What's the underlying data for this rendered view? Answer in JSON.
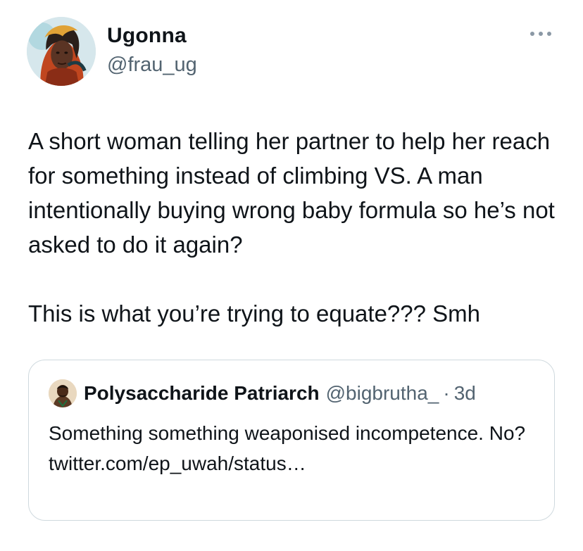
{
  "author": {
    "name": "Ugonna",
    "handle": "@frau_ug",
    "avatar_icon": "portrait-avatar-icon"
  },
  "menu": {
    "icon": "more-options-icon"
  },
  "tweet": {
    "paragraphs": [
      "A short woman telling her partner to help her reach for something instead of climbing VS. A man intentionally buying wrong baby formula so he’s not asked to do it again?",
      "This is what you’re trying to equate??? Smh"
    ]
  },
  "quoted": {
    "name": "Polysaccharide Patriarch",
    "handle": "@bigbrutha_",
    "separator": "·",
    "time": "3d",
    "text": "Something something weaponised incompetence. No? twitter.com/ep_uwah/status…",
    "avatar_icon": "portrait-avatar-icon"
  },
  "colors": {
    "text": "#0f1419",
    "secondary": "#536471",
    "border": "#cfd9de"
  }
}
